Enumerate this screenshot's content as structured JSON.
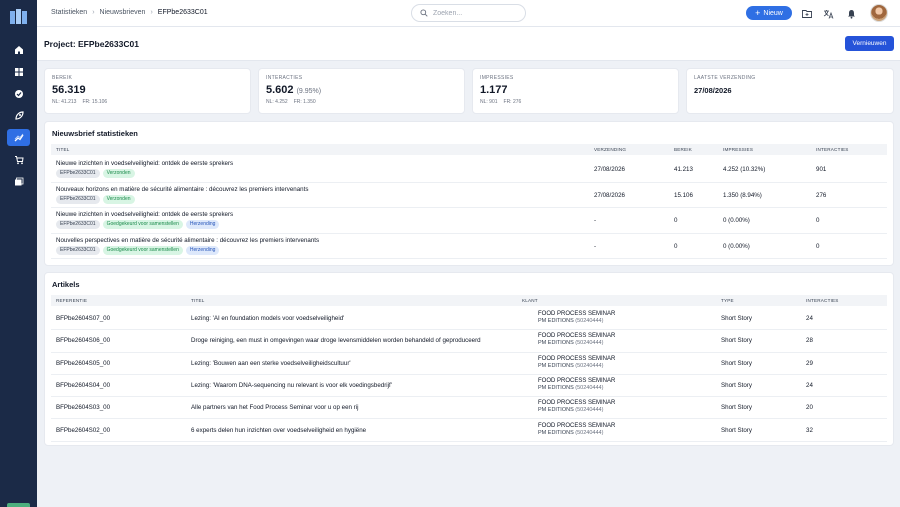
{
  "topbar": {
    "breadcrumb": [
      "Statistieken",
      "Nieuwsbrieven",
      "EFPbe2633C01"
    ],
    "search_placeholder": "Zoeken...",
    "new_label": "Nieuw"
  },
  "page": {
    "title": "Project: EFPbe2633C01",
    "refresh_label": "Vernieuwen"
  },
  "kpis": {
    "bereik": {
      "label": "BEREIK",
      "value": "56.319",
      "nl": "NL: 41.213",
      "fr": "FR: 15.106"
    },
    "interacties": {
      "label": "INTERACTIES",
      "value": "5.602",
      "pct": "(9.95%)",
      "nl": "NL: 4.252",
      "fr": "FR: 1.350"
    },
    "impressies": {
      "label": "IMPRESSIES",
      "value": "1.177",
      "nl": "NL: 901",
      "fr": "FR: 276"
    },
    "laatste": {
      "label": "LAATSTE VERZENDING",
      "value": "27/08/2026"
    }
  },
  "newsletter": {
    "title": "Nieuwsbrief statistieken",
    "headers": [
      "TITEL",
      "VERZENDING",
      "BEREIK",
      "IMPRESSIES",
      "INTERACTIES"
    ],
    "rows": [
      {
        "title": "Nieuwe inzichten in voedselveiligheid: ontdek de eerste sprekers",
        "code": "EFPbe2633C01",
        "status": "Verzonden",
        "status2": "",
        "date": "27/08/2026",
        "bereik": "41.213",
        "impressies": "4.252 (10.32%)",
        "interacties": "901"
      },
      {
        "title": "Nouveaux horizons en matière de sécurité alimentaire : découvrez les premiers intervenants",
        "code": "EFPbe2633C01",
        "status": "Verzonden",
        "status2": "",
        "date": "27/08/2026",
        "bereik": "15.106",
        "impressies": "1.350 (8.94%)",
        "interacties": "276"
      },
      {
        "title": "Nieuwe inzichten in voedselveiligheid: ontdek de eerste sprekers",
        "code": "EFPbe2633C01",
        "status": "Goedgekeurd voor samenstellen",
        "status2": "Herzending",
        "date": "-",
        "bereik": "0",
        "impressies": "0 (0.00%)",
        "interacties": "0"
      },
      {
        "title": "Nouvelles perspectives en matière de sécurité alimentaire : découvrez les premiers intervenants",
        "code": "EFPbe2633C01",
        "status": "Goedgekeurd voor samenstellen",
        "status2": "Herzending",
        "date": "-",
        "bereik": "0",
        "impressies": "0 (0.00%)",
        "interacties": "0"
      }
    ]
  },
  "articles": {
    "title": "Artikels",
    "headers": [
      "REFERENTIE",
      "TITEL",
      "KLANT",
      "TYPE",
      "INTERACTIES"
    ],
    "rows": [
      {
        "ref": "BFPbe2604S07_00",
        "title": "Lezing: 'AI en foundation models voor voedselveiligheid'",
        "client": "FOOD PROCESS SEMINAR",
        "company": "PM EDITIONS",
        "company_id": "(50240444)",
        "type": "Short Story",
        "interacties": "24"
      },
      {
        "ref": "BFPbe2604S06_00",
        "title": "Droge reiniging, een must in omgevingen waar droge levensmiddelen worden behandeld of geproduceerd",
        "client": "FOOD PROCESS SEMINAR",
        "company": "PM EDITIONS",
        "company_id": "(50240444)",
        "type": "Short Story",
        "interacties": "28"
      },
      {
        "ref": "BFPbe2604S05_00",
        "title": "Lezing: 'Bouwen aan een sterke voedselveiligheidscultuur'",
        "client": "FOOD PROCESS SEMINAR",
        "company": "PM EDITIONS",
        "company_id": "(50240444)",
        "type": "Short Story",
        "interacties": "29"
      },
      {
        "ref": "BFPbe2604S04_00",
        "title": "Lezing: 'Waarom DNA-sequencing nu relevant is voor elk voedingsbedrijf'",
        "client": "FOOD PROCESS SEMINAR",
        "company": "PM EDITIONS",
        "company_id": "(50240444)",
        "type": "Short Story",
        "interacties": "24"
      },
      {
        "ref": "BFPbe2604S03_00",
        "title": "Alle partners van het Food Process Seminar voor u op een rij",
        "client": "FOOD PROCESS SEMINAR",
        "company": "PM EDITIONS",
        "company_id": "(50240444)",
        "type": "Short Story",
        "interacties": "20"
      },
      {
        "ref": "BFPbe2604S02_00",
        "title": "6 experts delen hun inzichten over voedselveiligheid en hygiëne",
        "client": "FOOD PROCESS SEMINAR",
        "company": "PM EDITIONS",
        "company_id": "(50240444)",
        "type": "Short Story",
        "interacties": "32"
      }
    ]
  },
  "colors": {
    "accent": "#2f6fe4",
    "sidebar": "#1b2a47"
  }
}
